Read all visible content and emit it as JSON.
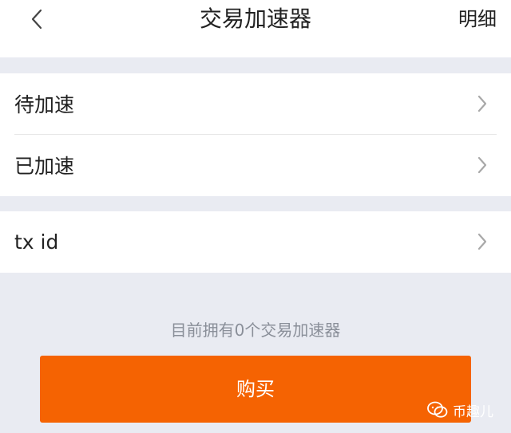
{
  "header": {
    "title": "交易加速器",
    "action_label": "明细",
    "back_icon": "chevron-left-icon"
  },
  "menu": {
    "items": [
      {
        "label": "待加速",
        "icon": "chevron-right-icon"
      },
      {
        "label": "已加速",
        "icon": "chevron-right-icon"
      },
      {
        "label": "tx id",
        "icon": "chevron-right-icon"
      }
    ]
  },
  "info": {
    "text": "目前拥有0个交易加速器"
  },
  "buy_button": {
    "label": "购买"
  },
  "watermark": {
    "text": "币趣儿",
    "icon": "wechat-icon"
  },
  "colors": {
    "accent": "#f56302",
    "background": "#e9ebf2",
    "surface": "#ffffff",
    "muted_text": "#8a8f99"
  }
}
